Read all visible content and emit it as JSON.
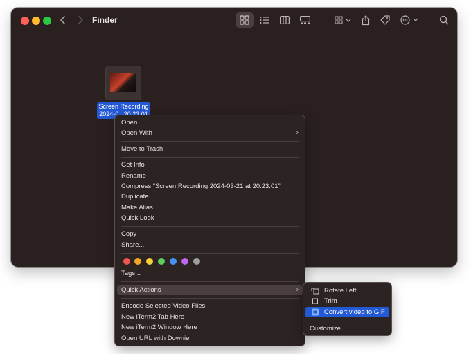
{
  "window": {
    "title": "Finder"
  },
  "file": {
    "label_line1": "Screen Recording",
    "label_line2": "2024-0...20.23.01"
  },
  "toolbar": {
    "icons": [
      "icon-view-icon",
      "list-view-icon",
      "column-view-icon",
      "gallery-view-icon",
      "group-icon",
      "share-icon",
      "tag-icon",
      "more-icon",
      "search-icon"
    ]
  },
  "context_menu": {
    "open": "Open",
    "open_with": "Open With",
    "move_to_trash": "Move to Trash",
    "get_info": "Get Info",
    "rename": "Rename",
    "compress": "Compress “Screen Recording 2024-03-21 at 20.23.01”",
    "duplicate": "Duplicate",
    "make_alias": "Make Alias",
    "quick_look": "Quick Look",
    "copy": "Copy",
    "share": "Share...",
    "tag_colors": [
      "#f0554e",
      "#f5a623",
      "#f7d038",
      "#5ccf5c",
      "#4a90f0",
      "#c067f0",
      "#9e9e9e"
    ],
    "tags": "Tags...",
    "quick_actions": "Quick Actions",
    "encode": "Encode Selected Video Files",
    "iterm_tab": "New iTerm2 Tab Here",
    "iterm_window": "New iTerm2 Window Here",
    "downie": "Open URL with Downie"
  },
  "quick_actions_submenu": {
    "rotate_left": "Rotate Left",
    "trim": "Trim",
    "convert_gif": "Convert video to GIF",
    "customize": "Customize..."
  },
  "colors": {
    "accent": "#2459d5",
    "window_bg": "#2a2020",
    "menu_bg": "#2c2323"
  }
}
